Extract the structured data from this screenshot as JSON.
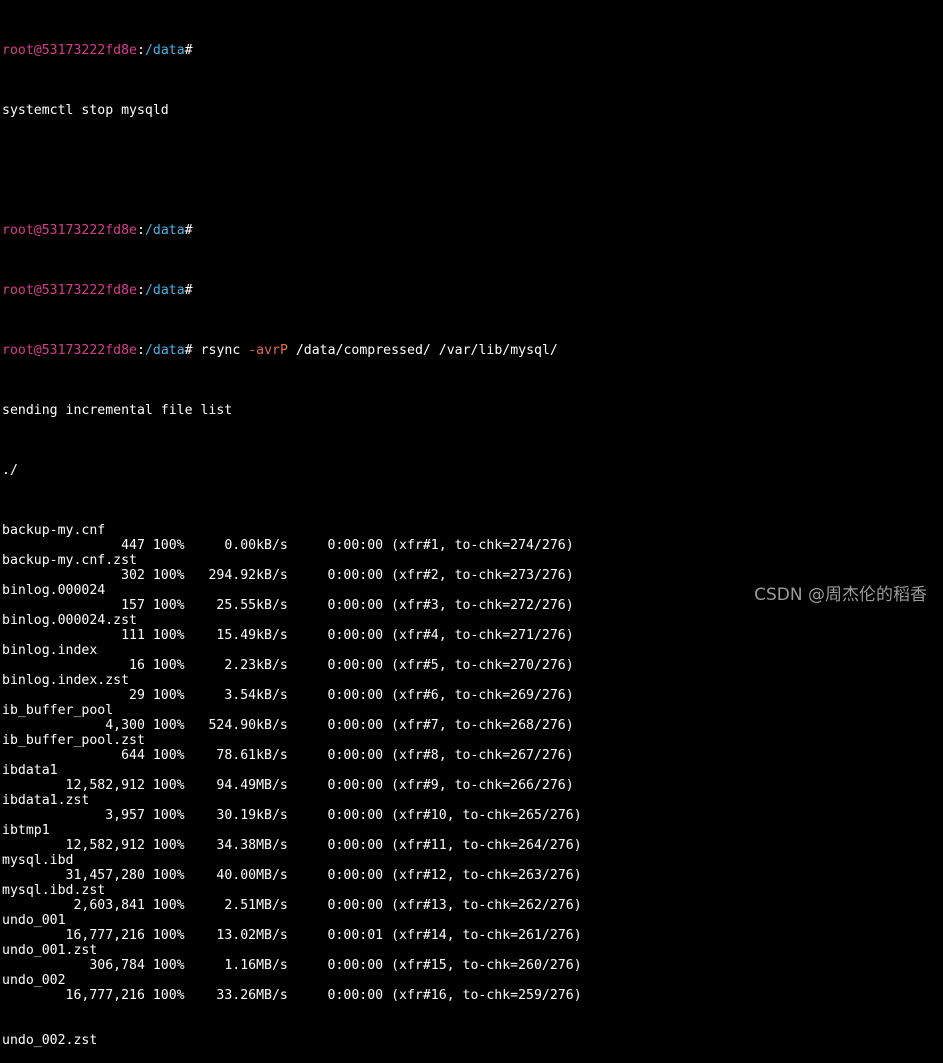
{
  "prompt": {
    "user": "root",
    "at": "@",
    "host": "53173222fd8e",
    "colon": ":",
    "cwd": "/data",
    "symbol": "#"
  },
  "commands": {
    "stop_mysql": "systemctl stop mysqld",
    "rsync_pre": "rsync ",
    "rsync_opt": "-avrP",
    "rsync_post": " /data/compressed/ /var/lib/mysql/"
  },
  "output": {
    "sending": "sending incremental file list",
    "dir": "./"
  },
  "transfers": [
    {
      "file": "backup-my.cnf",
      "size": "447",
      "pct": "100%",
      "rate": "0.00kB/s",
      "time": "0:00:00",
      "info": "(xfr#1, to-chk=274/276)"
    },
    {
      "file": "backup-my.cnf.zst",
      "size": "302",
      "pct": "100%",
      "rate": "294.92kB/s",
      "time": "0:00:00",
      "info": "(xfr#2, to-chk=273/276)"
    },
    {
      "file": "binlog.000024",
      "size": "157",
      "pct": "100%",
      "rate": "25.55kB/s",
      "time": "0:00:00",
      "info": "(xfr#3, to-chk=272/276)"
    },
    {
      "file": "binlog.000024.zst",
      "size": "111",
      "pct": "100%",
      "rate": "15.49kB/s",
      "time": "0:00:00",
      "info": "(xfr#4, to-chk=271/276)"
    },
    {
      "file": "binlog.index",
      "size": "16",
      "pct": "100%",
      "rate": "2.23kB/s",
      "time": "0:00:00",
      "info": "(xfr#5, to-chk=270/276)"
    },
    {
      "file": "binlog.index.zst",
      "size": "29",
      "pct": "100%",
      "rate": "3.54kB/s",
      "time": "0:00:00",
      "info": "(xfr#6, to-chk=269/276)"
    },
    {
      "file": "ib_buffer_pool",
      "size": "4,300",
      "pct": "100%",
      "rate": "524.90kB/s",
      "time": "0:00:00",
      "info": "(xfr#7, to-chk=268/276)"
    },
    {
      "file": "ib_buffer_pool.zst",
      "size": "644",
      "pct": "100%",
      "rate": "78.61kB/s",
      "time": "0:00:00",
      "info": "(xfr#8, to-chk=267/276)"
    },
    {
      "file": "ibdata1",
      "size": "12,582,912",
      "pct": "100%",
      "rate": "94.49MB/s",
      "time": "0:00:00",
      "info": "(xfr#9, to-chk=266/276)"
    },
    {
      "file": "ibdata1.zst",
      "size": "3,957",
      "pct": "100%",
      "rate": "30.19kB/s",
      "time": "0:00:00",
      "info": "(xfr#10, to-chk=265/276)"
    },
    {
      "file": "ibtmp1",
      "size": "12,582,912",
      "pct": "100%",
      "rate": "34.38MB/s",
      "time": "0:00:00",
      "info": "(xfr#11, to-chk=264/276)"
    },
    {
      "file": "mysql.ibd",
      "size": "31,457,280",
      "pct": "100%",
      "rate": "40.00MB/s",
      "time": "0:00:00",
      "info": "(xfr#12, to-chk=263/276)"
    },
    {
      "file": "mysql.ibd.zst",
      "size": "2,603,841",
      "pct": "100%",
      "rate": "2.51MB/s",
      "time": "0:00:00",
      "info": "(xfr#13, to-chk=262/276)"
    },
    {
      "file": "undo_001",
      "size": "16,777,216",
      "pct": "100%",
      "rate": "13.02MB/s",
      "time": "0:00:01",
      "info": "(xfr#14, to-chk=261/276)"
    },
    {
      "file": "undo_001.zst",
      "size": "306,784",
      "pct": "100%",
      "rate": "1.16MB/s",
      "time": "0:00:00",
      "info": "(xfr#15, to-chk=260/276)"
    },
    {
      "file": "undo_002",
      "size": "16,777,216",
      "pct": "100%",
      "rate": "33.26MB/s",
      "time": "0:00:00",
      "info": "(xfr#16, to-chk=259/276)"
    }
  ],
  "trailing_file": "undo_002.zst",
  "watermark": "CSDN @周杰伦的稻香",
  "colors": {
    "background": "#000000",
    "text": "#ffffff",
    "prompt_user": "#d93b8c",
    "prompt_path": "#3fb6e8",
    "option_flag": "#e36a4b",
    "watermark": "#9a9a9a"
  }
}
